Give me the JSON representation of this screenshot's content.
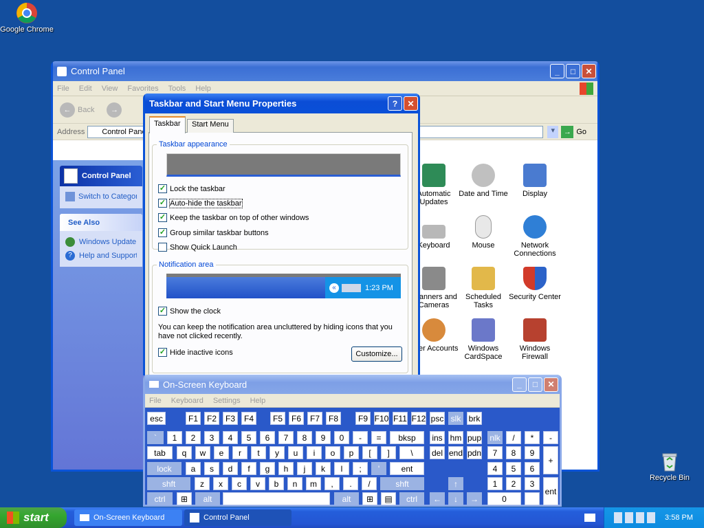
{
  "desktop": {
    "chrome_label": "Google Chrome",
    "recycle_label": "Recycle Bin"
  },
  "control_panel": {
    "title": "Control Panel",
    "menu": [
      "File",
      "Edit",
      "View",
      "Favorites",
      "Tools",
      "Help"
    ],
    "back_label": "Back",
    "address_label": "Address",
    "address_value": "Control Panel",
    "go_label": "Go",
    "panel_title": "Control Panel",
    "switch_link": "Switch to Category View",
    "see_also": "See Also",
    "see_also_items": [
      "Windows Update",
      "Help and Support"
    ],
    "items": [
      {
        "label": "Automatic Updates",
        "color": "#2e8b57"
      },
      {
        "label": "Date and Time",
        "color": "#c0c0c0"
      },
      {
        "label": "Display",
        "color": "#4a7bd0"
      },
      {
        "label": "Keyboard",
        "color": "#b8b8b8"
      },
      {
        "label": "Mouse",
        "color": "#e8e8e8"
      },
      {
        "label": "Network Connections",
        "color": "#2f7fd6"
      },
      {
        "label": "Scanners and Cameras",
        "color": "#8a8a8a"
      },
      {
        "label": "Scheduled Tasks",
        "color": "#e2b84a"
      },
      {
        "label": "Security Center",
        "color": "#d23b2a"
      },
      {
        "label": "User Accounts",
        "color": "#d88a3c"
      },
      {
        "label": "Windows CardSpace",
        "color": "#6b78c9"
      },
      {
        "label": "Windows Firewall",
        "color": "#b7412f"
      }
    ]
  },
  "taskbar_props": {
    "title": "Taskbar and Start Menu Properties",
    "tabs": [
      "Taskbar",
      "Start Menu"
    ],
    "group_appearance": "Taskbar appearance",
    "options": [
      {
        "label": "Lock the taskbar",
        "checked": true
      },
      {
        "label": "Auto-hide the taskbar",
        "checked": true
      },
      {
        "label": "Keep the taskbar on top of other windows",
        "checked": true
      },
      {
        "label": "Group similar taskbar buttons",
        "checked": true
      },
      {
        "label": "Show Quick Launch",
        "checked": false
      }
    ],
    "group_notification": "Notification area",
    "preview_time": "1:23 PM",
    "show_clock": "Show the clock",
    "info_text": "You can keep the notification area uncluttered by hiding icons that you have not clicked recently.",
    "hide_inactive": "Hide inactive icons",
    "customize_button": "Customize..."
  },
  "osk": {
    "title": "On-Screen Keyboard",
    "menu": [
      "File",
      "Keyboard",
      "Settings",
      "Help"
    ]
  },
  "taskbar": {
    "start_label": "start",
    "tasks": [
      "On-Screen Keyboard",
      "Control Panel"
    ],
    "clock": "3:58 PM"
  }
}
